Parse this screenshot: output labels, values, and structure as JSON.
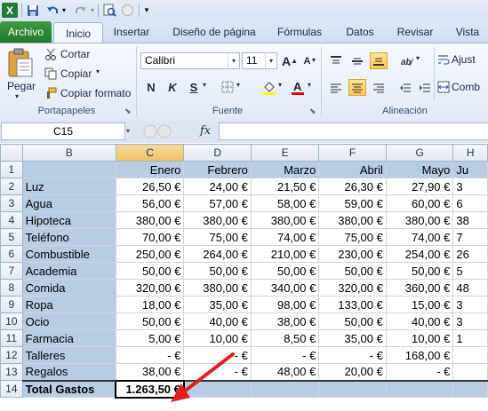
{
  "colors": {
    "header_fill": "#b8cce4",
    "file_tab": "#2e8b3a",
    "arrow": "#e02020",
    "selection": "#f1c15f"
  },
  "quick_access": {
    "logo_letter": "X",
    "icons": [
      "save-icon",
      "undo-icon",
      "redo-icon",
      "print-preview-icon",
      "print-icon",
      "customize-icon"
    ]
  },
  "tabs": [
    {
      "label": "Archivo"
    },
    {
      "label": "Inicio"
    },
    {
      "label": "Insertar"
    },
    {
      "label": "Diseño de página"
    },
    {
      "label": "Fórmulas"
    },
    {
      "label": "Datos"
    },
    {
      "label": "Revisar"
    },
    {
      "label": "Vista"
    }
  ],
  "clipboard": {
    "paste": "Pegar",
    "cut": "Cortar",
    "copy": "Copiar",
    "format_painter": "Copiar formato",
    "group": "Portapapeles"
  },
  "font": {
    "name": "Calibri",
    "size": "11",
    "bold": "N",
    "italic": "K",
    "underline": "S",
    "group": "Fuente"
  },
  "alignment": {
    "wrap": "Ajust",
    "merge": "Comb",
    "group": "Alineación"
  },
  "formula_bar": {
    "name_box": "C15",
    "fx": "fx",
    "content": ""
  },
  "sheet": {
    "columns": [
      "B",
      "C",
      "D",
      "E",
      "F",
      "G",
      "H"
    ],
    "partial_col_label": "Ju",
    "month_row": [
      "",
      "Enero",
      "Febrero",
      "Marzo",
      "Abril",
      "Mayo",
      "Ju"
    ],
    "rows": [
      {
        "n": "2",
        "label": "Luz",
        "vals": [
          "26,50 €",
          "24,00 €",
          "21,50 €",
          "26,30 €",
          "27,90 €",
          "3"
        ]
      },
      {
        "n": "3",
        "label": "Agua",
        "vals": [
          "56,00 €",
          "57,00 €",
          "58,00 €",
          "59,00 €",
          "60,00 €",
          "6"
        ]
      },
      {
        "n": "4",
        "label": "Hipoteca",
        "vals": [
          "380,00 €",
          "380,00 €",
          "380,00 €",
          "380,00 €",
          "380,00 €",
          "38"
        ]
      },
      {
        "n": "5",
        "label": "Teléfono",
        "vals": [
          "70,00 €",
          "75,00 €",
          "74,00 €",
          "75,00 €",
          "74,00 €",
          "7"
        ]
      },
      {
        "n": "6",
        "label": "Combustible",
        "vals": [
          "250,00 €",
          "264,00 €",
          "210,00 €",
          "230,00 €",
          "254,00 €",
          "26"
        ]
      },
      {
        "n": "7",
        "label": "Academia",
        "vals": [
          "50,00 €",
          "50,00 €",
          "50,00 €",
          "50,00 €",
          "50,00 €",
          "5"
        ]
      },
      {
        "n": "8",
        "label": "Comida",
        "vals": [
          "320,00 €",
          "380,00 €",
          "340,00 €",
          "320,00 €",
          "360,00 €",
          "48"
        ]
      },
      {
        "n": "9",
        "label": "Ropa",
        "vals": [
          "18,00 €",
          "35,00 €",
          "98,00 €",
          "133,00 €",
          "15,00 €",
          "3"
        ]
      },
      {
        "n": "10",
        "label": "Ocio",
        "vals": [
          "50,00 €",
          "40,00 €",
          "38,00 €",
          "50,00 €",
          "40,00 €",
          "3"
        ]
      },
      {
        "n": "11",
        "label": "Farmacia",
        "vals": [
          "5,00 €",
          "10,00 €",
          "8,50 €",
          "35,00 €",
          "10,00 €",
          "1"
        ]
      },
      {
        "n": "12",
        "label": "Talleres",
        "vals": [
          "-    €",
          "-    €",
          "-    €",
          "-    €",
          "168,00 €",
          ""
        ]
      },
      {
        "n": "13",
        "label": "Regalos",
        "vals": [
          "38,00 €",
          "-    €",
          "48,00 €",
          "20,00 €",
          "-    €",
          ""
        ]
      }
    ],
    "total_row": {
      "n": "14",
      "label": "Total Gastos",
      "value": "1.263,50 €"
    },
    "row1_n": "1"
  }
}
